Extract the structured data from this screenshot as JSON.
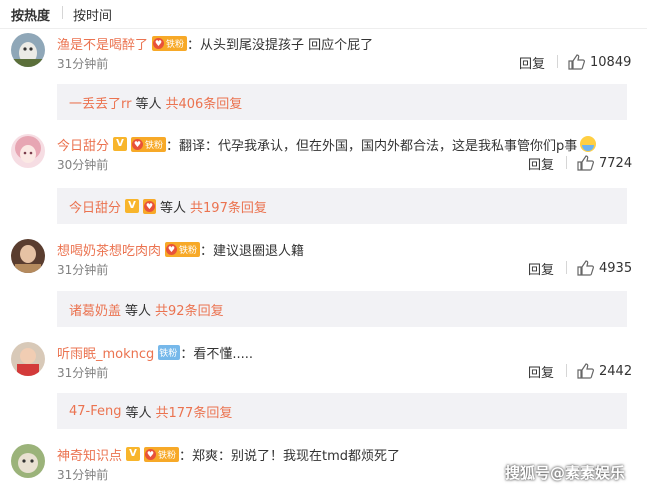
{
  "sort": {
    "hot": "按热度",
    "time": "按时间"
  },
  "comments": [
    {
      "name": "渔是不是喝醉了",
      "verified": false,
      "fan_badge": "铁粉",
      "fan_badge_color": "orange",
      "text": "：从头到尾没提孩子 回应个屁了",
      "time": "31分钟前",
      "reply": "回复",
      "likes": "10849",
      "thread": {
        "who": "一丢丢了rr",
        "etc": "等人",
        "count": "共406条回复"
      },
      "avatar_icon": "avatar-cat-icon"
    },
    {
      "name": "今日甜分",
      "verified": true,
      "fan_badge": "铁粉",
      "fan_badge_color": "orange",
      "text": "：翻译：代孕我承认，但在外国，国内外都合法，这是我私事管你们p事",
      "time": "30分钟前",
      "reply": "回复",
      "likes": "7724",
      "thread": {
        "who": "今日甜分",
        "etc": "等人",
        "count": "共197条回复"
      },
      "avatar_icon": "avatar-anime-girl-icon"
    },
    {
      "name": "想喝奶茶想吃肉肉",
      "verified": false,
      "fan_badge": "铁粉",
      "fan_badge_color": "orange",
      "text": "：建议退圈退人籍",
      "time": "31分钟前",
      "reply": "回复",
      "likes": "4935",
      "thread": {
        "who": "诸葛奶盖",
        "etc": "等人",
        "count": "共92条回复"
      },
      "avatar_icon": "avatar-person-icon"
    },
    {
      "name": "听雨眠_mokncg",
      "verified": false,
      "fan_badge": "铁粉",
      "fan_badge_color": "blue",
      "text": "：看不懂.....",
      "time": "31分钟前",
      "reply": "回复",
      "likes": "2442",
      "thread": {
        "who": "47-Feng",
        "etc": "等人",
        "count": "共177条回复"
      },
      "avatar_icon": "avatar-child-icon"
    },
    {
      "name": "神奇知识点",
      "verified": true,
      "fan_badge": "铁粉",
      "fan_badge_color": "orange",
      "text": "：郑爽：别说了！我现在tmd都烦死了",
      "time": "31分钟前",
      "reply": "",
      "likes": "",
      "thread": null,
      "avatar_icon": "avatar-cat-icon"
    }
  ],
  "watermark": "搜狐号@素素娱乐",
  "colors": {
    "username": "#eb7350",
    "reply_bg": "#f2f2f5",
    "badge_orange": "#f7a928",
    "badge_blue": "#76b8ea",
    "verified": "#f8b52b"
  }
}
